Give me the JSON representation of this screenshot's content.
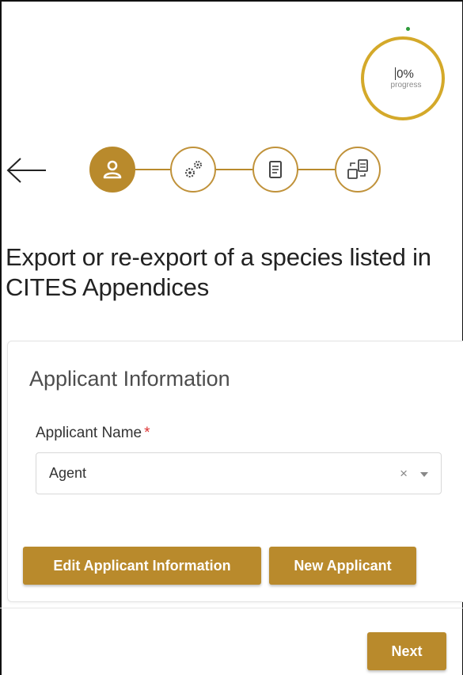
{
  "progress": {
    "value": "0%",
    "label": "progress",
    "fraction": 0,
    "ring_color": "#d4a92a"
  },
  "stepper": {
    "steps": [
      {
        "icon": "person-icon",
        "active": true
      },
      {
        "icon": "gears-icon",
        "active": false
      },
      {
        "icon": "document-icon",
        "active": false
      },
      {
        "icon": "transfer-documents-icon",
        "active": false
      }
    ],
    "accent_color": "#b98a2c"
  },
  "page": {
    "title": "Export or re-export of a species listed in CITES Appendices"
  },
  "applicant": {
    "section_title": "Applicant Information",
    "name_label": "Applicant Name",
    "required_mark": "*",
    "name_value": "Agent",
    "clear_symbol": "×"
  },
  "actions": {
    "edit_label": "Edit Applicant Information",
    "new_label": "New Applicant",
    "next_label": "Next"
  }
}
